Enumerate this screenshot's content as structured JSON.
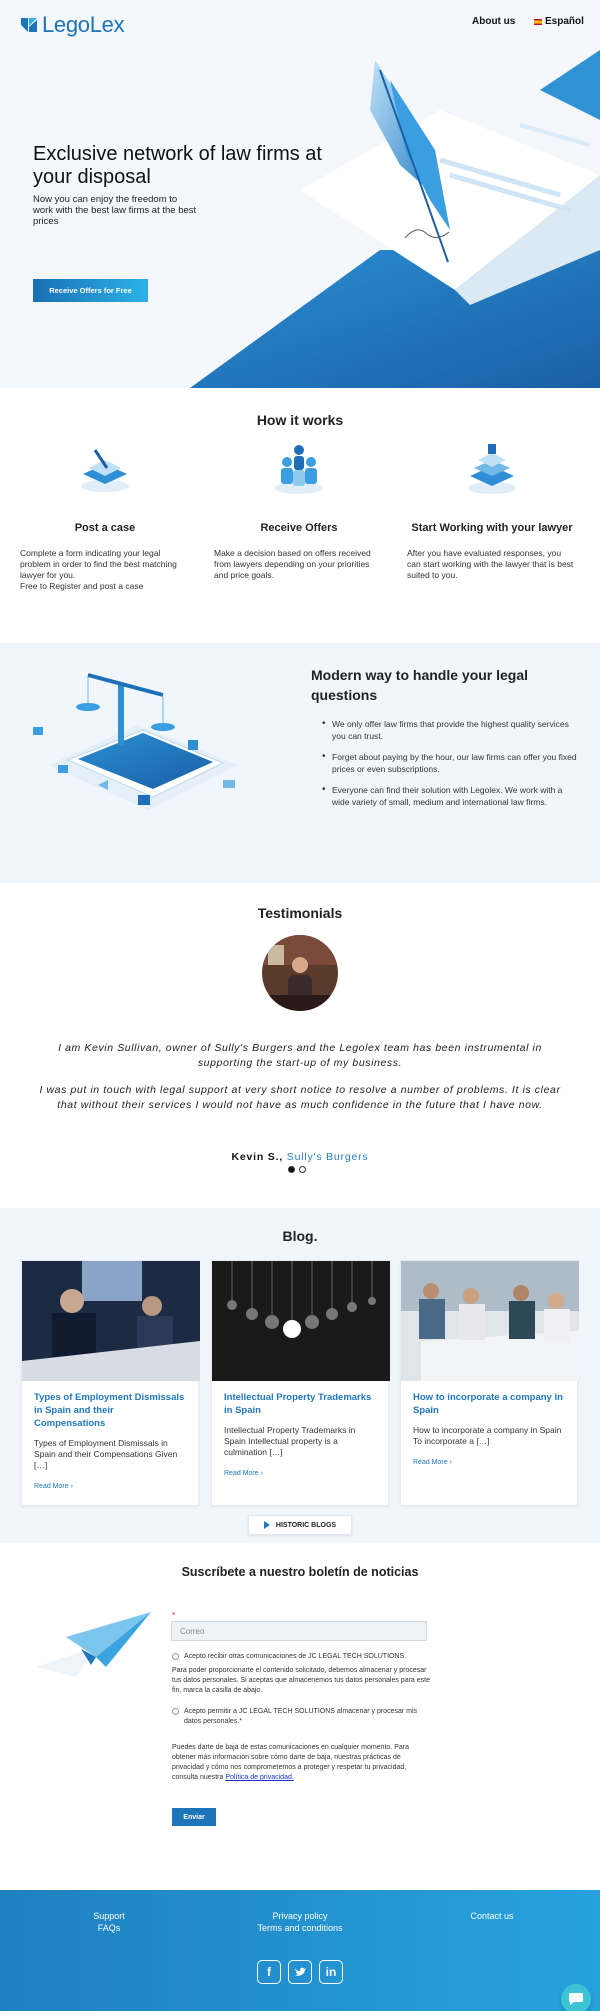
{
  "header": {
    "brand": "LegoLex",
    "nav": {
      "about": "About us",
      "language": "Español"
    }
  },
  "hero": {
    "title": "Exclusive network of law firms at your disposal",
    "subtitle": "Now you can enjoy the freedom to work with the best law firms at the best prices",
    "cta": "Receive Offers for Free"
  },
  "how": {
    "title": "How it works",
    "steps": [
      {
        "title": "Post a case",
        "text": "Complete a form indicating your legal problem in order to find the best matching lawyer for you.\nFree to Register and post a case",
        "icon": "form-icon"
      },
      {
        "title": "Receive Offers",
        "text": "Make a decision based on offers received from lawyers depending on your priorities and price goals.",
        "icon": "people-icon"
      },
      {
        "title": "Start Working with your lawyer",
        "text": "After you have evaluated responses, you can start working with the lawyer that is best suited to you.",
        "icon": "stack-icon"
      }
    ]
  },
  "modern": {
    "title": "Modern way to handle your legal questions",
    "points": [
      "We only offer law firms that provide the highest quality services you can trust.",
      "Forget about paying by the hour, our law firms can offer you fixed prices or even subscriptions.",
      "Everyone can find their solution with Legolex. We work with a wide variety of small, medium and international law firms."
    ]
  },
  "testimonials": {
    "title": "Testimonials",
    "quote1": "I am Kevin Sullivan, owner of Sully's Burgers and the Legolex team has been instrumental in supporting the start-up of my business.",
    "quote2": "I was put in touch with legal support at very short notice to resolve a number of problems. It is clear that without their services I would not have as much confidence in the future that I have now.",
    "author": "Kevin S.,",
    "company": "Sully's Burgers"
  },
  "blog": {
    "title": "Blog.",
    "posts": [
      {
        "title": "Types of Employment Dismissals in Spain and their Compensations",
        "excerpt": "Types of Employment Dismissals in Spain and their Compensations Given […]",
        "more": "Read More ›"
      },
      {
        "title": "Intellectual Property Trademarks in Spain",
        "excerpt": "Intellectual Property Trademarks in Spain Intellectual property is a culmination […]",
        "more": "Read More ›"
      },
      {
        "title": "How to incorporate a company in Spain",
        "excerpt": "How to incorporate a company in Spain To incorporate a […]",
        "more": "Read More ›"
      }
    ],
    "historic": "HISTORIC BLOGS"
  },
  "newsletter": {
    "title": "Suscríbete a nuestro boletín de noticias",
    "required": "*",
    "email_placeholder": "Correo",
    "consent1": "Acepto recibir otras comunicaciones de JC LEGAL TECH SOLUTIONS.",
    "info": "Para poder proporcionarte el contenido solicitado, debemos almacenar y procesar tus datos personales. Si aceptas que almacenemos tus datos personales para este fin, marca la casilla de abajo.",
    "consent2": "Acepto permitir a JC LEGAL TECH SOLUTIONS almacenar y procesar mis datos personales.*",
    "unsubscribe": "Puedes darte de baja de estas comunicaciones en cualquier momento. Para obtener más información sobre cómo darte de baja, nuestras prácticas de privacidad y cómo nos comprometemos a proteger y respetar tu privacidad, consulta nuestra",
    "policy_link": "Política de privacidad.",
    "submit": "Enviar"
  },
  "footer": {
    "support": "Support",
    "faqs": "FAQs",
    "privacy": "Privacy policy",
    "terms": "Terms and conditions",
    "contact": "Contact us",
    "social": [
      "f",
      "t",
      "in"
    ]
  },
  "colors": {
    "brand": "#1d74b9",
    "accent": "#2bb2e8",
    "link": "#2178bd"
  }
}
